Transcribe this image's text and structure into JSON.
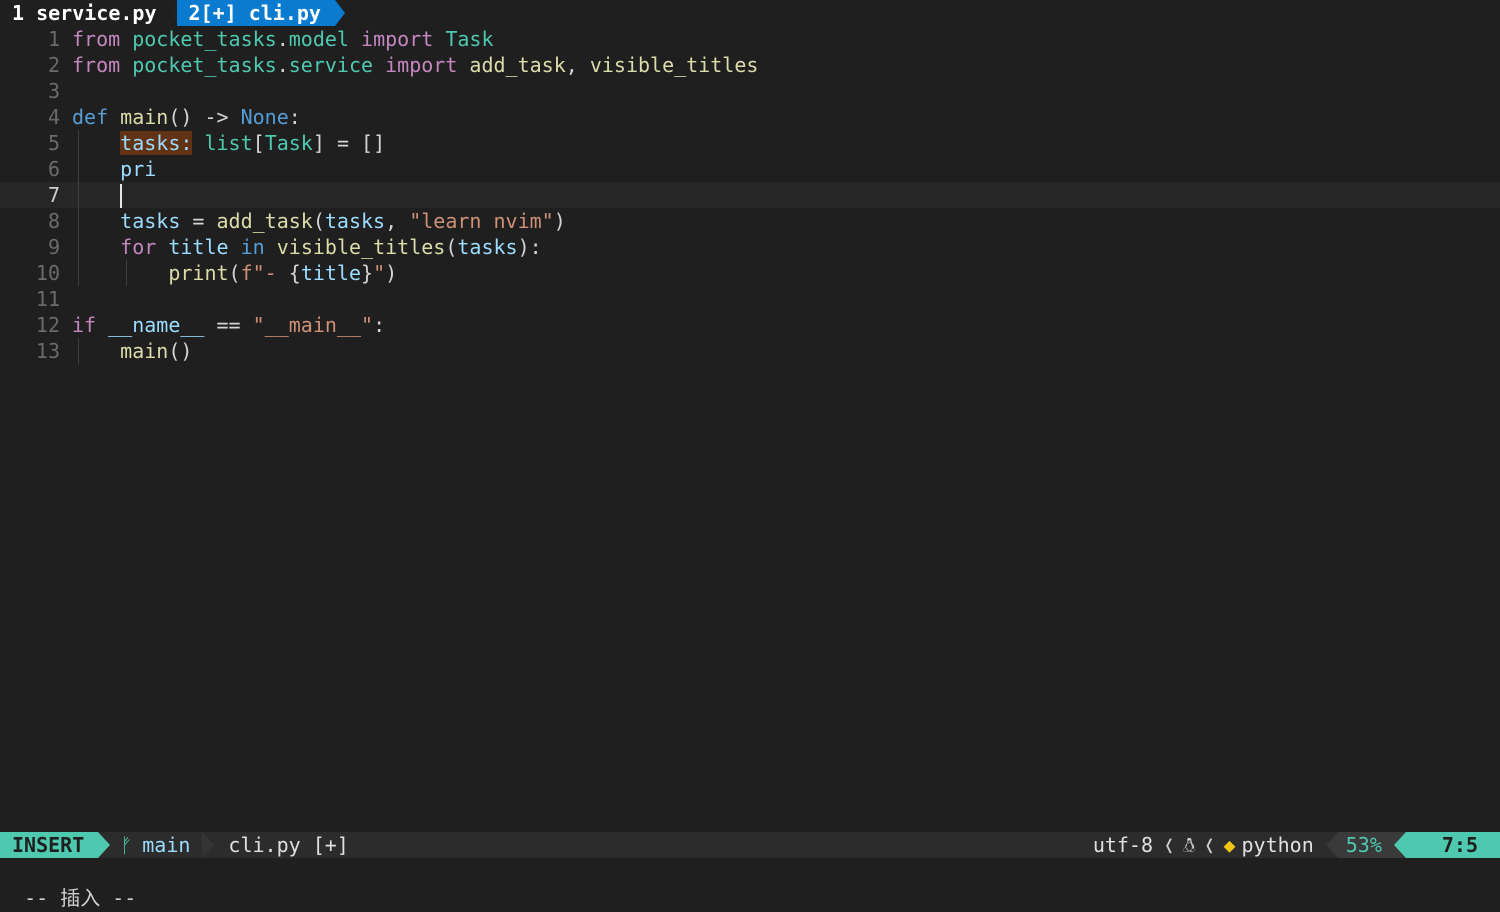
{
  "tabs": [
    {
      "label": "1 service.py",
      "active": false
    },
    {
      "label": "2[+] cli.py",
      "active": true
    }
  ],
  "editor": {
    "current_line": 7,
    "lines": [
      {
        "n": "1",
        "tokens": [
          [
            "kw",
            "from"
          ],
          [
            "op",
            " "
          ],
          [
            "mod",
            "pocket_tasks"
          ],
          [
            "op",
            "."
          ],
          [
            "mod",
            "model"
          ],
          [
            "op",
            " "
          ],
          [
            "kw",
            "import"
          ],
          [
            "op",
            " "
          ],
          [
            "cls",
            "Task"
          ]
        ]
      },
      {
        "n": "2",
        "tokens": [
          [
            "kw",
            "from"
          ],
          [
            "op",
            " "
          ],
          [
            "mod",
            "pocket_tasks"
          ],
          [
            "op",
            "."
          ],
          [
            "mod",
            "service"
          ],
          [
            "op",
            " "
          ],
          [
            "kw",
            "import"
          ],
          [
            "op",
            " "
          ],
          [
            "fn",
            "add_task"
          ],
          [
            "op",
            ", "
          ],
          [
            "fn",
            "visible_titles"
          ]
        ]
      },
      {
        "n": "3",
        "tokens": []
      },
      {
        "n": "4",
        "tokens": [
          [
            "kd",
            "def"
          ],
          [
            "op",
            " "
          ],
          [
            "fn",
            "main"
          ],
          [
            "op",
            "() -> "
          ],
          [
            "kd",
            "None"
          ],
          [
            "op",
            ":"
          ]
        ]
      },
      {
        "n": "5",
        "tokens": [
          [
            "op",
            "    "
          ],
          [
            "hl",
            "tasks:"
          ],
          [
            "op",
            " "
          ],
          [
            "cls",
            "list"
          ],
          [
            "op",
            "["
          ],
          [
            "cls",
            "Task"
          ],
          [
            "op",
            "] = []"
          ]
        ]
      },
      {
        "n": "6",
        "tokens": [
          [
            "op",
            "    "
          ],
          [
            "var",
            "pri"
          ]
        ]
      },
      {
        "n": "7",
        "tokens": [
          [
            "op",
            "    "
          ]
        ]
      },
      {
        "n": "8",
        "tokens": [
          [
            "op",
            "    "
          ],
          [
            "var",
            "tasks"
          ],
          [
            "op",
            " = "
          ],
          [
            "fn",
            "add_task"
          ],
          [
            "op",
            "("
          ],
          [
            "var",
            "tasks"
          ],
          [
            "op",
            ", "
          ],
          [
            "str",
            "\"learn nvim\""
          ],
          [
            "op",
            ")"
          ]
        ]
      },
      {
        "n": "9",
        "tokens": [
          [
            "op",
            "    "
          ],
          [
            "kw",
            "for"
          ],
          [
            "op",
            " "
          ],
          [
            "var",
            "title"
          ],
          [
            "op",
            " "
          ],
          [
            "kd",
            "in"
          ],
          [
            "op",
            " "
          ],
          [
            "fn",
            "visible_titles"
          ],
          [
            "op",
            "("
          ],
          [
            "var",
            "tasks"
          ],
          [
            "op",
            "):"
          ]
        ]
      },
      {
        "n": "10",
        "tokens": [
          [
            "op",
            "        "
          ],
          [
            "fn",
            "print"
          ],
          [
            "op",
            "("
          ],
          [
            "str",
            "f\"- "
          ],
          [
            "op",
            "{"
          ],
          [
            "var",
            "title"
          ],
          [
            "op",
            "}"
          ],
          [
            "str",
            "\""
          ],
          [
            "op",
            ")"
          ]
        ]
      },
      {
        "n": "11",
        "tokens": []
      },
      {
        "n": "12",
        "tokens": [
          [
            "kw",
            "if"
          ],
          [
            "op",
            " "
          ],
          [
            "var",
            "__name__"
          ],
          [
            "op",
            " == "
          ],
          [
            "str",
            "\"__main__\""
          ],
          [
            "op",
            ":"
          ]
        ]
      },
      {
        "n": "13",
        "tokens": [
          [
            "op",
            "    "
          ],
          [
            "fn",
            "main"
          ],
          [
            "op",
            "()"
          ]
        ]
      }
    ]
  },
  "statusline": {
    "mode": "INSERT",
    "branch_icon": "git-branch-icon",
    "branch": "main",
    "filename": "cli.py [+]",
    "encoding": "utf-8",
    "os_icon": "linux-tux-icon",
    "filetype_icon": "python-icon",
    "filetype": "python",
    "percent": "53%",
    "position": "7:5"
  },
  "cmdline": {
    "text": "-- 插入 --"
  }
}
